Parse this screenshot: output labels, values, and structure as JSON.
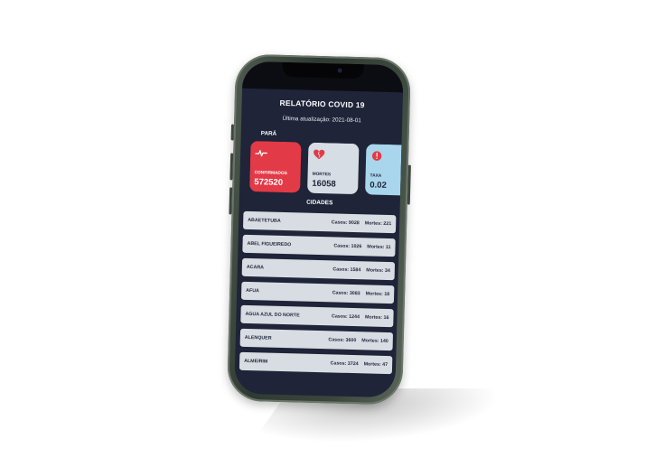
{
  "app": {
    "title": "RELATÓRIO COVID 19",
    "updated": "Última atualização: 2021-08-01",
    "region": "PARÁ",
    "cities_title": "CIDADES"
  },
  "cards": [
    {
      "label": "CONFIRMADOS",
      "value": "572520",
      "icon": "heartbeat-icon",
      "color": "#e23a47"
    },
    {
      "label": "MORTES",
      "value": "16058",
      "icon": "broken-heart-icon",
      "color": "#d6dde4"
    },
    {
      "label": "TAXA",
      "value": "0.02",
      "icon": "alert-icon",
      "color": "#a9d6ec"
    }
  ],
  "cities": [
    {
      "name": "ABAETETUBA",
      "cases": "Casos: 9028",
      "deaths": "Mortes: 221"
    },
    {
      "name": "ABEL FIGUEIREDO",
      "cases": "Casos: 1026",
      "deaths": "Mortes: 11"
    },
    {
      "name": "ACARÁ",
      "cases": "Casos: 1584",
      "deaths": "Mortes: 34"
    },
    {
      "name": "AFUÁ",
      "cases": "Casos: 3083",
      "deaths": "Mortes: 18"
    },
    {
      "name": "ÁGUA AZUL DO NORTE",
      "cases": "Casos: 1244",
      "deaths": "Mortes: 16"
    },
    {
      "name": "ALENQUER",
      "cases": "Casos: 3600",
      "deaths": "Mortes: 140"
    },
    {
      "name": "ALMEIRIM",
      "cases": "Casos: 3724",
      "deaths": "Mortes: 47"
    }
  ],
  "colors": {
    "screen_bg": "#1f2438",
    "accent_red": "#e23a47",
    "card_gray": "#d6dde4",
    "card_blue": "#a9d6ec",
    "row_bg": "#d8dde3"
  }
}
